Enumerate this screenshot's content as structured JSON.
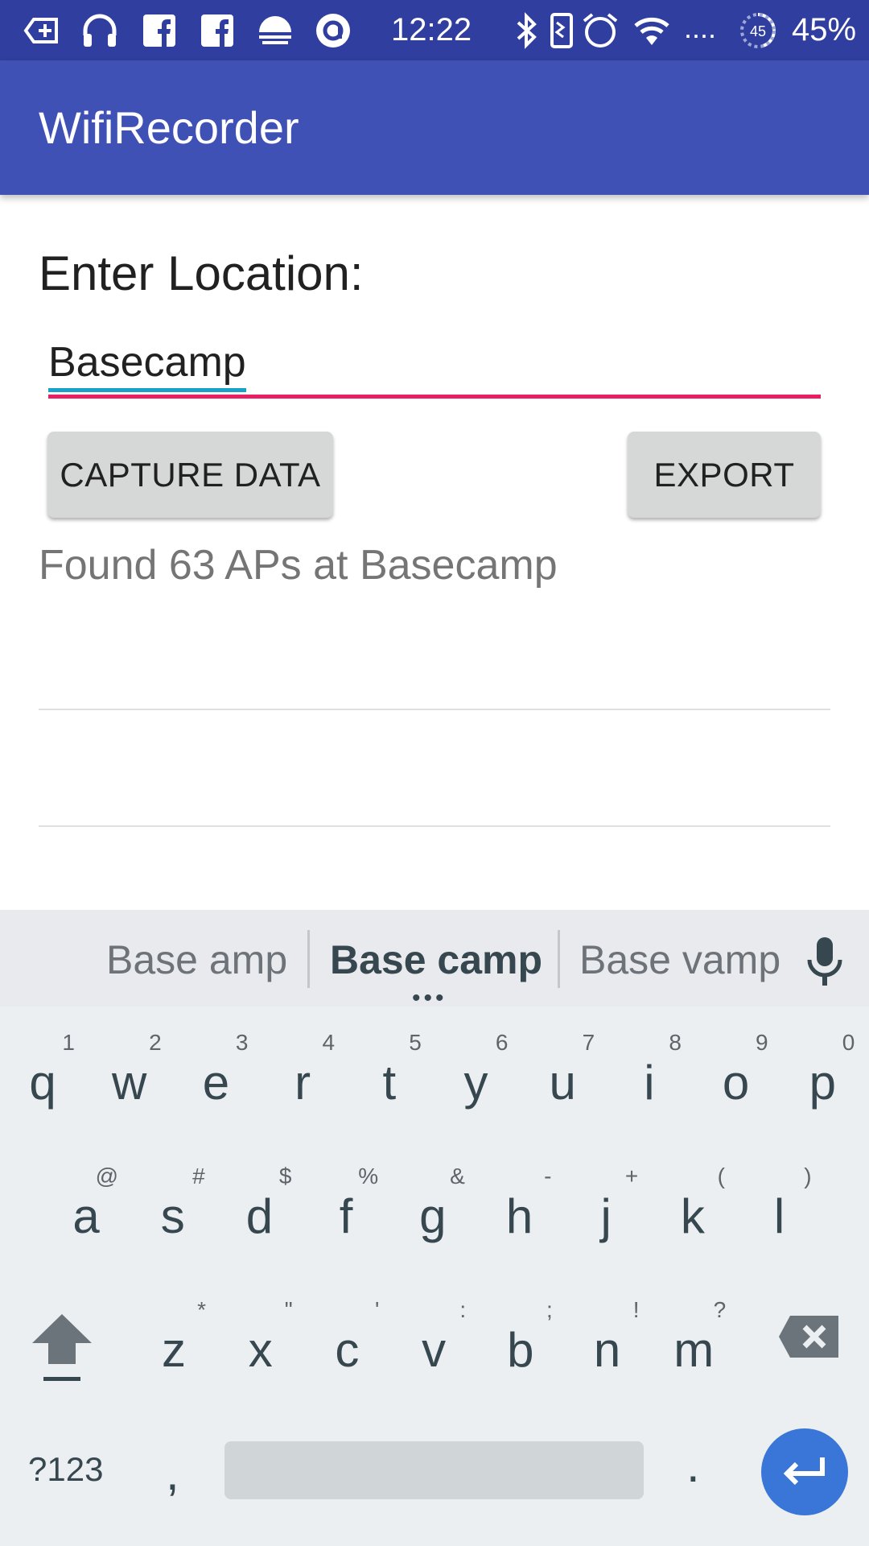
{
  "status_bar": {
    "time": "12:22",
    "battery_percent": "45%",
    "battery_ring_value": "45",
    "signal_dots": "....",
    "icons": [
      "screen-add-icon",
      "headphones-icon",
      "facebook-icon",
      "facebook-icon-2",
      "sunset-icon",
      "circle-app-icon",
      "bluetooth-icon",
      "vibrate-icon",
      "alarm-icon",
      "wifi-icon",
      "signal-icon",
      "battery-saver-icon"
    ],
    "bg_color": "#303f9f"
  },
  "app_bar": {
    "title": "WifiRecorder",
    "bg_color": "#3f51b5"
  },
  "form": {
    "location_label": "Enter Location:",
    "location_value": "Basecamp",
    "capture_button": "CAPTURE DATA",
    "export_button": "EXPORT",
    "status_message": "Found 63 APs at Basecamp",
    "accent_color": "#e91e63"
  },
  "keyboard": {
    "suggestions": [
      "Base amp",
      "Base camp",
      "Base vamp"
    ],
    "suggestion_more": "•••",
    "row1": [
      {
        "char": "q",
        "hint": "1"
      },
      {
        "char": "w",
        "hint": "2"
      },
      {
        "char": "e",
        "hint": "3"
      },
      {
        "char": "r",
        "hint": "4"
      },
      {
        "char": "t",
        "hint": "5"
      },
      {
        "char": "y",
        "hint": "6"
      },
      {
        "char": "u",
        "hint": "7"
      },
      {
        "char": "i",
        "hint": "8"
      },
      {
        "char": "o",
        "hint": "9"
      },
      {
        "char": "p",
        "hint": "0"
      }
    ],
    "row2": [
      {
        "char": "a",
        "hint": "@"
      },
      {
        "char": "s",
        "hint": "#"
      },
      {
        "char": "d",
        "hint": "$"
      },
      {
        "char": "f",
        "hint": "%"
      },
      {
        "char": "g",
        "hint": "&"
      },
      {
        "char": "h",
        "hint": "-"
      },
      {
        "char": "j",
        "hint": "+"
      },
      {
        "char": "k",
        "hint": "("
      },
      {
        "char": "l",
        "hint": ")"
      }
    ],
    "row3": [
      {
        "char": "z",
        "hint": "*"
      },
      {
        "char": "x",
        "hint": "\""
      },
      {
        "char": "c",
        "hint": "'"
      },
      {
        "char": "v",
        "hint": ":"
      },
      {
        "char": "b",
        "hint": ";"
      },
      {
        "char": "n",
        "hint": "!"
      },
      {
        "char": "m",
        "hint": "?"
      }
    ],
    "symbols_key": "?123",
    "comma_key": ",",
    "period_key": ".",
    "enter_color": "#3a75d8"
  }
}
